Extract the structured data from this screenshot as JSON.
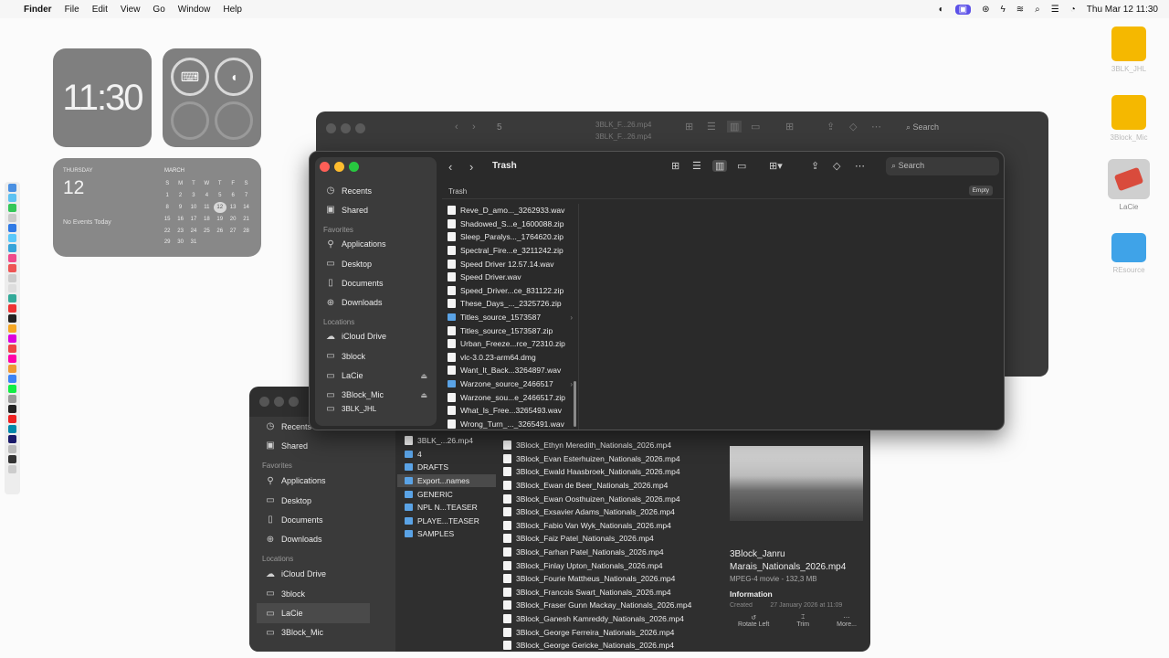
{
  "menubar": {
    "apple": "",
    "app": "Finder",
    "items": [
      "File",
      "Edit",
      "View",
      "Go",
      "Window",
      "Help"
    ],
    "datetime": "Thu Mar 12  11:30"
  },
  "widgets": {
    "clock": "11:30",
    "calendar": {
      "weekday": "THURSDAY",
      "day": "12",
      "events": "No Events Today",
      "month": "MARCH",
      "dow": [
        "S",
        "M",
        "T",
        "W",
        "T",
        "F",
        "S"
      ],
      "rows": [
        [
          "",
          "",
          "",
          "",
          "",
          "",
          ""
        ],
        [
          "1",
          "2",
          "3",
          "4",
          "5",
          "6",
          "7"
        ],
        [
          "8",
          "9",
          "10",
          "11",
          "12",
          "13",
          "14"
        ],
        [
          "15",
          "16",
          "17",
          "18",
          "19",
          "20",
          "21"
        ],
        [
          "22",
          "23",
          "24",
          "25",
          "26",
          "27",
          "28"
        ],
        [
          "29",
          "30",
          "31",
          "",
          "",
          "",
          ""
        ]
      ]
    }
  },
  "desktop_icons": [
    {
      "label": "3BLK_JHL",
      "color": "#f5b800"
    },
    {
      "label": "3Block_Mic",
      "color": "#f5b800"
    },
    {
      "label": "LaCie",
      "color": "#d94b3c"
    },
    {
      "label": "REsource",
      "color": "#3fa3e8"
    }
  ],
  "back_window": {
    "path": "5",
    "search": "Search",
    "files": [
      "3BLK_F...26.mp4",
      "3BLK_F...26.mp4"
    ]
  },
  "trash_window": {
    "title": "Trash",
    "search_placeholder": "Search",
    "column_header": "Trash",
    "empty_button": "Empty",
    "sidebar": {
      "recents": "Recents",
      "shared": "Shared",
      "favorites_header": "Favorites",
      "favorites": [
        "Applications",
        "Desktop",
        "Documents",
        "Downloads"
      ],
      "locations_header": "Locations",
      "locations": [
        "iCloud Drive",
        "3block",
        "LaCie",
        "3Block_Mic",
        "3BLK_JHL"
      ]
    },
    "files": [
      {
        "name": "Reve_D_amo..._3262933.wav",
        "kind": "file"
      },
      {
        "name": "Shadowed_S...e_1600088.zip",
        "kind": "file"
      },
      {
        "name": "Sleep_Paralys..._1764620.zip",
        "kind": "file"
      },
      {
        "name": "Spectral_Fire...e_3211242.zip",
        "kind": "file"
      },
      {
        "name": "Speed Driver 12.57.14.wav",
        "kind": "file"
      },
      {
        "name": "Speed Driver.wav",
        "kind": "file"
      },
      {
        "name": "Speed_Driver...ce_831122.zip",
        "kind": "file"
      },
      {
        "name": "These_Days_..._2325726.zip",
        "kind": "file"
      },
      {
        "name": "Titles_source_1573587",
        "kind": "folder"
      },
      {
        "name": "Titles_source_1573587.zip",
        "kind": "file"
      },
      {
        "name": "Urban_Freeze...rce_72310.zip",
        "kind": "file"
      },
      {
        "name": "vlc-3.0.23-arm64.dmg",
        "kind": "file"
      },
      {
        "name": "Want_It_Back...3264897.wav",
        "kind": "file"
      },
      {
        "name": "Warzone_source_2466517",
        "kind": "folder"
      },
      {
        "name": "Warzone_sou...e_2466517.zip",
        "kind": "file"
      },
      {
        "name": "What_Is_Free...3265493.wav",
        "kind": "file"
      },
      {
        "name": "Wrong_Turn_..._3265491.wav",
        "kind": "file"
      }
    ]
  },
  "bottom_window": {
    "sidebar": {
      "recents": "Recents",
      "shared": "Shared",
      "favorites_header": "Favorites",
      "favorites": [
        "Applications",
        "Desktop",
        "Documents",
        "Downloads"
      ],
      "locations_header": "Locations",
      "locations": [
        "iCloud Drive",
        "3block",
        "LaCie",
        "3Block_Mic"
      ]
    },
    "col1": [
      "3BLK_...26.mp4",
      "4",
      "DRAFTS",
      "Export...names",
      "GENERIC",
      "NPL N...TEASER",
      "PLAYE...TEASER",
      "SAMPLES"
    ],
    "col2": [
      "3Block_Ethyn Meredith_Nationals_2026.mp4",
      "3Block_Evan Esterhuizen_Nationals_2026.mp4",
      "3Block_Ewald Haasbroek_Nationals_2026.mp4",
      "3Block_Ewan de Beer_Nationals_2026.mp4",
      "3Block_Ewan Oosthuizen_Nationals_2026.mp4",
      "3Block_Exsavier Adams_Nationals_2026.mp4",
      "3Block_Fabio Van Wyk_Nationals_2026.mp4",
      "3Block_Faiz Patel_Nationals_2026.mp4",
      "3Block_Farhan Patel_Nationals_2026.mp4",
      "3Block_Finlay Upton_Nationals_2026.mp4",
      "3Block_Fourie Mattheus_Nationals_2026.mp4",
      "3Block_Francois Swart_Nationals_2026.mp4",
      "3Block_Fraser Gunn Mackay_Nationals_2026.mp4",
      "3Block_Ganesh Kamreddy_Nationals_2026.mp4",
      "3Block_George Ferreira_Nationals_2026.mp4",
      "3Block_George Gericke_Nationals_2026.mp4"
    ],
    "preview": {
      "name": "3Block_Janru Marais_Nationals_2026.mp4",
      "kind": "MPEG-4 movie - 132,3 MB",
      "info_header": "Information",
      "created_label": "Created",
      "created_value": "27 January 2026 at 11:09",
      "actions": [
        "Rotate Left",
        "Trim",
        "More..."
      ]
    }
  }
}
